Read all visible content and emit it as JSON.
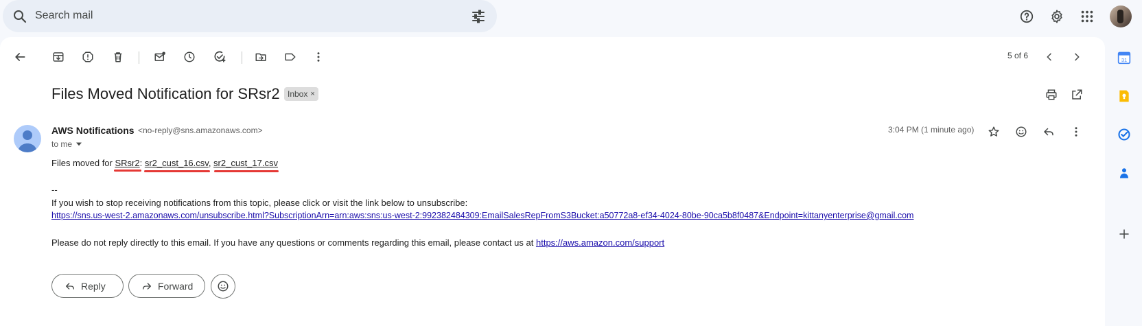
{
  "search": {
    "placeholder": "Search mail"
  },
  "top_icons": [
    "help-icon",
    "settings-gear-icon",
    "apps-grid-icon",
    "account-avatar"
  ],
  "toolbar": {
    "icons": [
      "back-arrow-icon",
      "archive-icon",
      "report-spam-icon",
      "delete-icon",
      "mark-unread-icon",
      "snooze-icon",
      "add-to-tasks-icon",
      "move-to-icon",
      "labels-icon",
      "more-vert-icon"
    ],
    "pager_text": "5 of 6"
  },
  "email": {
    "subject": "Files Moved Notification for SRsr2",
    "label_chip": "Inbox",
    "label_chip_close": "×",
    "sender_name": "AWS Notifications",
    "sender_email": "<no-reply@sns.amazonaws.com>",
    "to_text": "to me",
    "timestamp": "3:04 PM (1 minute ago)",
    "body": {
      "line1_prefix": "Files moved for ",
      "line1_project": "SRsr2",
      "line1_sep1": ": ",
      "file1": "sr2_cust_16.csv",
      "line1_sep2": ", ",
      "file2": "sr2_cust_17.csv",
      "dashes": "--",
      "unsubscribe_intro": "If you wish to stop receiving notifications from this topic, please click or visit the link below to unsubscribe:",
      "unsubscribe_link": "https://sns.us-west-2.amazonaws.com/unsubscribe.html?SubscriptionArn=arn:aws:sns:us-west-2:992382484309:EmailSalesRepFromS3Bucket:a50772a8-ef34-4024-80be-90ca5b8f0487&Endpoint=kittanyenterprise@gmail.com",
      "support_text": "Please do not reply directly to this email. If you have any questions or comments regarding this email, please contact us at ",
      "support_link": "https://aws.amazon.com/support"
    }
  },
  "actions": {
    "reply_label": "Reply",
    "forward_label": "Forward"
  },
  "side_panel": {
    "calendar_day": "31"
  },
  "colors": {
    "annotation_red": "#e53935",
    "link_blue": "#1a0dab",
    "accent": "#0b57d0"
  }
}
